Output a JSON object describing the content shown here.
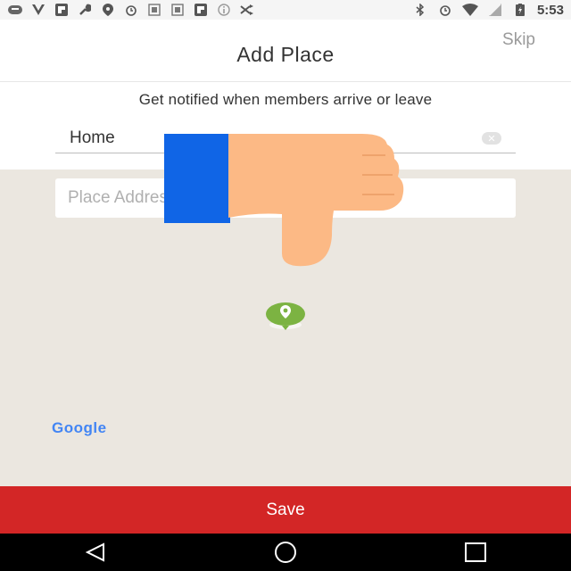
{
  "status_bar": {
    "time": "5:53",
    "icons": [
      "keyboard-icon",
      "v-icon",
      "flipboard-icon",
      "wrench-icon",
      "location-icon",
      "alarm-icon",
      "image-icon",
      "image-icon",
      "flipboard-icon",
      "info-icon",
      "shuffle-icon",
      "bluetooth-icon",
      "alarm-icon",
      "wifi-icon",
      "signal-icon",
      "battery-charging-icon"
    ]
  },
  "header": {
    "title": "Add Place",
    "skip_label": "Skip"
  },
  "form": {
    "subtitle": "Get notified when members arrive or leave",
    "place_name_value": "Home",
    "address_placeholder": "Place Address"
  },
  "map": {
    "attribution": "Google",
    "pin_color": "#7cb342"
  },
  "save_label": "Save",
  "colors": {
    "accent": "#d32626",
    "overlay_blue": "#1065e6",
    "overlay_hand": "#fcb985"
  }
}
